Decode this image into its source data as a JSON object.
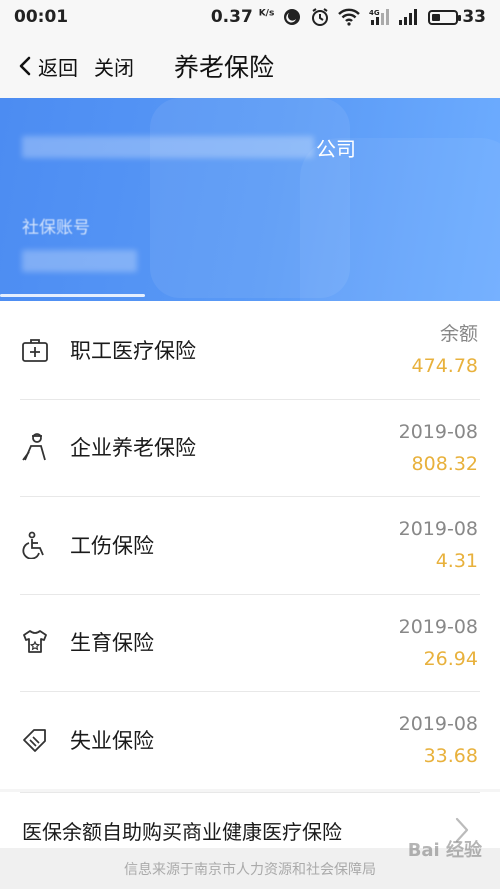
{
  "status_bar": {
    "time": "00:01",
    "speed": "0.37",
    "speed_unit": "K/s",
    "battery": "33",
    "battery_level_percent": 33,
    "network_label": "4G"
  },
  "nav": {
    "back_label": "返回",
    "close_label": "关闭",
    "title": "养老保险"
  },
  "banner": {
    "company_suffix": "公司",
    "account_label": "社保账号"
  },
  "list": {
    "items": [
      {
        "label": "职工医疗保险",
        "meta": "余额",
        "amount": "474.78",
        "icon": "medical-kit-icon"
      },
      {
        "label": "企业养老保险",
        "meta": "2019-08",
        "amount": "808.32",
        "icon": "elderly-person-icon"
      },
      {
        "label": "工伤保险",
        "meta": "2019-08",
        "amount": "4.31",
        "icon": "wheelchair-icon"
      },
      {
        "label": "生育保险",
        "meta": "2019-08",
        "amount": "26.94",
        "icon": "baby-onesie-icon"
      },
      {
        "label": "失业保险",
        "meta": "2019-08",
        "amount": "33.68",
        "icon": "briefcase-tag-icon"
      }
    ]
  },
  "purchase": {
    "label": "医保余额自助购买商业健康医疗保险"
  },
  "footer": {
    "text": "信息来源于南京市人力资源和社会保障局"
  },
  "watermark": "Bai 经验",
  "colors": {
    "accent_blue": "#5a9af6",
    "amount_gold": "#e8b13c"
  }
}
